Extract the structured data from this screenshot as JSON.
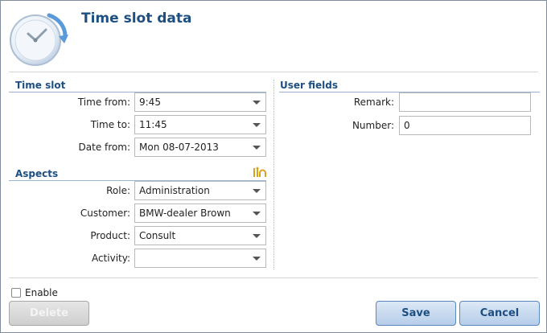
{
  "dialog": {
    "title": "Time slot data"
  },
  "time_slot": {
    "section_title": "Time slot",
    "time_from_label": "Time from:",
    "time_from_value": "9:45",
    "time_to_label": "Time to:",
    "time_to_value": "11:45",
    "date_from_label": "Date from:",
    "date_from_value": "Mon 08-07-2013"
  },
  "aspects": {
    "section_title": "Aspects",
    "role_label": "Role:",
    "role_value": "Administration",
    "customer_label": "Customer:",
    "customer_value": "BMW-dealer Brown",
    "product_label": "Product:",
    "product_value": "Consult",
    "activity_label": "Activity:",
    "activity_value": ""
  },
  "user_fields": {
    "section_title": "User fields",
    "remark_label": "Remark:",
    "remark_value": "",
    "number_label": "Number:",
    "number_value": "0"
  },
  "footer": {
    "enable_label": "Enable",
    "enable_checked": false,
    "delete_label": "Delete",
    "save_label": "Save",
    "cancel_label": "Cancel"
  },
  "colors": {
    "title": "#1d4f82",
    "button_border": "#5a88bf"
  },
  "icons": {
    "header": "clock-icon",
    "aspects_action": "restore-icon",
    "dropdown": "chevron-down-icon"
  }
}
